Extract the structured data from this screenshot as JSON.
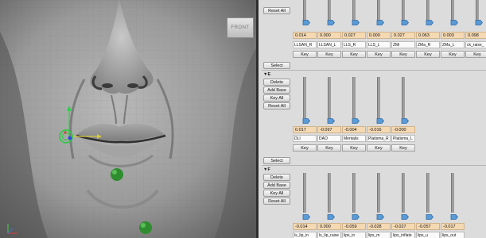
{
  "viewport": {
    "cube_label": "FRONT"
  },
  "section_top": {
    "reset_all": "Reset All",
    "values": [
      "0.014",
      "0.000",
      "0.027",
      "0.000",
      "0.027",
      "0.063",
      "0.003",
      "0.098"
    ],
    "names": [
      "LLSAN_R",
      "LLSAN_L",
      "LLS_R",
      "LLS_L",
      "ZMi",
      "ZMa_R",
      "ZMa_L",
      "ck_raise_"
    ],
    "key_label": "Key"
  },
  "section_e": {
    "select_label": "Select",
    "header": "▼E",
    "buttons": [
      "Delete",
      "Add Base",
      "Key All",
      "Reset All"
    ],
    "values": [
      "0.017",
      "-0.097",
      "-0.004",
      "-0.016",
      "-0.000"
    ],
    "names": [
      "DLI",
      "DAO",
      "Mentalis",
      "Platisma_R",
      "Platisma_L"
    ],
    "key_label": "Key"
  },
  "section_f": {
    "select_label": "Select",
    "header": "▼F",
    "buttons": [
      "Delete",
      "Add Base",
      "Key All",
      "Reset All"
    ],
    "values": [
      "-0.014",
      "0.000",
      "-0.059",
      "-0.028",
      "-0.027",
      "-0.057",
      "-0.017"
    ],
    "names": [
      "ls_lip_in",
      "ls_lip_raise",
      "lips_in",
      "lips_m",
      "lips_inflate",
      "lips_u",
      "lips_out"
    ]
  },
  "colors": {
    "value_field": "#f4d9b3",
    "thumb": "#5b9bd5",
    "manipulator_green": "#21b24a"
  }
}
